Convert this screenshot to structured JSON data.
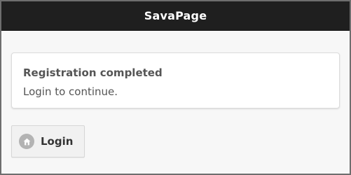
{
  "header": {
    "title": "SavaPage"
  },
  "message": {
    "title": "Registration completed",
    "text": "Login to continue."
  },
  "login_button": {
    "label": "Login",
    "icon": "home-icon"
  },
  "colors": {
    "header_bg": "#1f1f1f",
    "page_bg": "#f7f7f7",
    "card_bg": "#ffffff",
    "text": "#555555"
  }
}
